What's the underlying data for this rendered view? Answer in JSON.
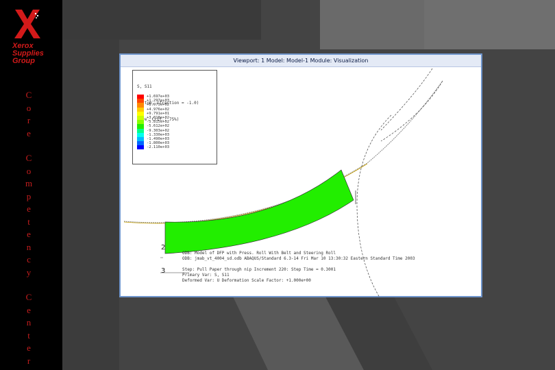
{
  "brand": {
    "logo_letter": "X",
    "lines": [
      "Xerox",
      "Supplies",
      "Group"
    ],
    "color": "#d31a1a"
  },
  "sidebar_vertical": [
    "C",
    "o",
    "r",
    "e",
    "",
    "C",
    "o",
    "m",
    "p",
    "e",
    "t",
    "e",
    "n",
    "c",
    "y",
    "",
    "C",
    "e",
    "n",
    "t",
    "e",
    "r"
  ],
  "viewport": {
    "title": "Viewport: 1   Model: Model-1   Module: Visualization"
  },
  "legend": {
    "header": [
      "S, S11",
      "Bottom, (fraction = -1.0)",
      "(Ave. Crit.: 75%)"
    ],
    "rows": [
      {
        "color": "#ff0000",
        "value": "+1.697e+03"
      },
      {
        "color": "#ff4400",
        "value": "+1.297e+03"
      },
      {
        "color": "#ff8800",
        "value": "+8.973e+02"
      },
      {
        "color": "#ffcc00",
        "value": "+4.976e+02"
      },
      {
        "color": "#ffff00",
        "value": "+9.791e+01"
      },
      {
        "color": "#ccff00",
        "value": "+3.018e+02"
      },
      {
        "color": "#88ff00",
        "value": "-5.815e+02"
      },
      {
        "color": "#22ee00",
        "value": "-5.612e+02"
      },
      {
        "color": "#00ff88",
        "value": "-9.303e+02"
      },
      {
        "color": "#00ffee",
        "value": "-1.330e+03"
      },
      {
        "color": "#00bbff",
        "value": "-1.490e+03"
      },
      {
        "color": "#0066ff",
        "value": "-1.800e+03"
      },
      {
        "color": "#0000ff",
        "value": "-2.110e+03"
      }
    ]
  },
  "info": {
    "line1": "ODB: Model of DFP with Press. Roll   With Belt and Steering Roll",
    "line2": "ODB: jmab_vt_4004_sd.odb   ABAQUS/Standard 6.3-14   Fri Mar 10 13:30:32 Eastern Standard Time 2003",
    "line3": "Step: Pull Paper through nip   Increment   220: Step Time =   0.3001",
    "line4": "Primary Var: S, S11",
    "line5": "Deformed Var: U   Deformation Scale Factor: +1.000e+00",
    "marker2": "2",
    "marker3": "3"
  },
  "colors": {
    "shape_fill": "#22ee00",
    "viewport_border": "#6f95cc",
    "background": "#4a4a4a"
  }
}
